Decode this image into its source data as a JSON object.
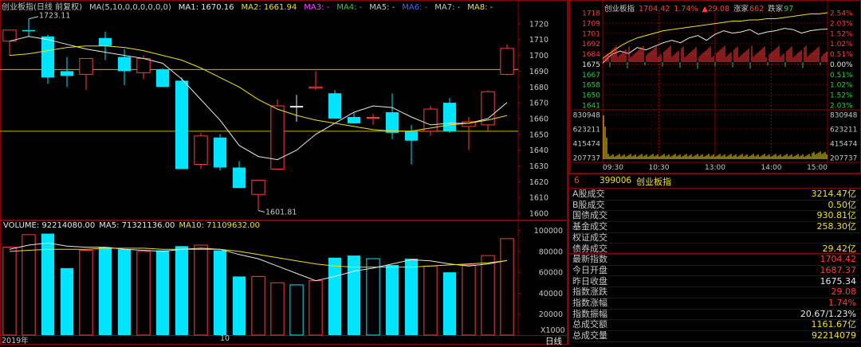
{
  "main_chart": {
    "title": "创业板指(日线 前复权)",
    "ma_legend": [
      {
        "label": "MA(5,10,0,0,0,0,0,0)",
        "color": "#c8c8c8"
      },
      {
        "label": "MA1: 1670.16",
        "color": "#e8e8e8"
      },
      {
        "label": "MA2: 1661.94",
        "color": "#f0e020"
      },
      {
        "label": "MA3: -",
        "color": "#ff40ff"
      },
      {
        "label": "MA4: -",
        "color": "#2ecc40"
      },
      {
        "label": "MA5: -",
        "color": "#c8c8c8"
      },
      {
        "label": "MA6: -",
        "color": "#3a6bff"
      },
      {
        "label": "MA7: -",
        "color": "#c8c8c8"
      },
      {
        "label": "MA8: -",
        "color": "#f0e020"
      }
    ],
    "high_annotation": "1723.11",
    "low_annotation": "1601.81",
    "y_ticks": [
      "1720",
      "1710",
      "1700",
      "1690",
      "1680",
      "1670",
      "1660",
      "1650",
      "1640",
      "1630",
      "1620",
      "1610",
      "1600"
    ]
  },
  "volume_chart": {
    "legend": [
      {
        "label": "VOLUME: 92214080.00",
        "color": "#e8e8e8"
      },
      {
        "label": "MA5: 71321136.00",
        "color": "#e8e8e8"
      },
      {
        "label": "MA10: 71109632.00",
        "color": "#f0e020"
      }
    ],
    "y_ticks": [
      "100000",
      "80000",
      "60000",
      "40000",
      "20000"
    ],
    "unit": "X1000",
    "x_labels": [
      "2019年",
      "10"
    ]
  },
  "period_label": "日线",
  "chart_data": [
    {
      "type": "candlestick",
      "title": "创业板指(日线 前复权)",
      "ylim": [
        1597,
        1728
      ],
      "candles": [
        {
          "o": 1709,
          "h": 1714,
          "l": 1700,
          "c": 1716,
          "dir": "up"
        },
        {
          "o": 1716,
          "h": 1723.11,
          "l": 1712,
          "c": 1716,
          "dir": "flat"
        },
        {
          "o": 1712,
          "h": 1713,
          "l": 1682,
          "c": 1686,
          "dir": "down"
        },
        {
          "o": 1690,
          "h": 1699,
          "l": 1680,
          "c": 1687,
          "dir": "down"
        },
        {
          "o": 1688,
          "h": 1698,
          "l": 1678,
          "c": 1698,
          "dir": "up"
        },
        {
          "o": 1711,
          "h": 1715,
          "l": 1697,
          "c": 1706,
          "dir": "down"
        },
        {
          "o": 1699,
          "h": 1704,
          "l": 1681,
          "c": 1690,
          "dir": "down"
        },
        {
          "o": 1689,
          "h": 1700,
          "l": 1685,
          "c": 1698,
          "dir": "up"
        },
        {
          "o": 1691,
          "h": 1692,
          "l": 1681,
          "c": 1680,
          "dir": "down"
        },
        {
          "o": 1684,
          "h": 1686,
          "l": 1628,
          "c": 1628,
          "dir": "down"
        },
        {
          "o": 1631,
          "h": 1651,
          "l": 1628,
          "c": 1649,
          "dir": "up"
        },
        {
          "o": 1648,
          "h": 1650,
          "l": 1627,
          "c": 1629,
          "dir": "down"
        },
        {
          "o": 1629,
          "h": 1633,
          "l": 1616,
          "c": 1616,
          "dir": "down"
        },
        {
          "o": 1612,
          "h": 1620,
          "l": 1601.81,
          "c": 1621,
          "dir": "up"
        },
        {
          "o": 1628,
          "h": 1672,
          "l": 1628,
          "c": 1668,
          "dir": "up"
        },
        {
          "o": 1667,
          "h": 1675,
          "l": 1658,
          "c": 1668,
          "dir": "flat"
        },
        {
          "o": 1680,
          "h": 1690,
          "l": 1678,
          "c": 1680,
          "dir": "up"
        },
        {
          "o": 1676,
          "h": 1678,
          "l": 1660,
          "c": 1660,
          "dir": "down"
        },
        {
          "o": 1661,
          "h": 1664,
          "l": 1657,
          "c": 1657,
          "dir": "down"
        },
        {
          "o": 1660,
          "h": 1663,
          "l": 1656,
          "c": 1661,
          "dir": "flat"
        },
        {
          "o": 1664,
          "h": 1676,
          "l": 1647,
          "c": 1651,
          "dir": "down"
        },
        {
          "o": 1652,
          "h": 1656,
          "l": 1631,
          "c": 1646,
          "dir": "down"
        },
        {
          "o": 1652,
          "h": 1668,
          "l": 1649,
          "c": 1666,
          "dir": "up"
        },
        {
          "o": 1670,
          "h": 1673,
          "l": 1651,
          "c": 1652,
          "dir": "down"
        },
        {
          "o": 1655,
          "h": 1661,
          "l": 1640,
          "c": 1658,
          "dir": "up"
        },
        {
          "o": 1656,
          "h": 1678,
          "l": 1652,
          "c": 1677,
          "dir": "up"
        },
        {
          "o": 1688,
          "h": 1707,
          "l": 1687.37,
          "c": 1704.42,
          "dir": "up"
        }
      ],
      "ma1": [
        1709,
        1712,
        1710,
        1707,
        1704,
        1702,
        1700,
        1698,
        1695,
        1685,
        1672,
        1659,
        1643,
        1636,
        1634,
        1640,
        1650,
        1657,
        1664,
        1668,
        1667,
        1661,
        1656,
        1657,
        1657,
        1660,
        1670.16
      ],
      "ma2": [
        1700,
        1701,
        1703,
        1705,
        1706,
        1706,
        1705,
        1703,
        1700,
        1697,
        1692,
        1686,
        1680,
        1672,
        1666,
        1662,
        1659,
        1657,
        1655,
        1653,
        1652,
        1652,
        1654,
        1656,
        1657,
        1659,
        1661.94
      ],
      "hlines": [
        1691,
        1652
      ]
    },
    {
      "type": "bar",
      "title": "VOLUME",
      "ylim": [
        0,
        105000
      ],
      "values": [
        84000,
        96000,
        97000,
        64000,
        81000,
        84000,
        82000,
        80000,
        81000,
        85000,
        86000,
        81000,
        56000,
        56000,
        50000,
        48000,
        52000,
        74000,
        76000,
        73000,
        67000,
        73000,
        66000,
        60000,
        67000,
        76000,
        92214
      ],
      "dirs": [
        "up",
        "up",
        "down",
        "down",
        "up",
        "down",
        "down",
        "up",
        "down",
        "down",
        "up",
        "down",
        "down",
        "up",
        "up",
        "flat",
        "up",
        "down",
        "down",
        "flat",
        "down",
        "down",
        "up",
        "down",
        "up",
        "up",
        "up"
      ],
      "ma5": [
        82000,
        86000,
        88000,
        85000,
        84000,
        84000,
        82000,
        81000,
        80000,
        82000,
        83000,
        82000,
        77000,
        73000,
        66000,
        59000,
        52000,
        56000,
        61000,
        64000,
        68000,
        72000,
        71000,
        68000,
        66000,
        68000,
        71321
      ],
      "ma10": [
        80000,
        81000,
        82000,
        82000,
        82000,
        83000,
        83000,
        83000,
        82000,
        82000,
        82000,
        82000,
        80000,
        77000,
        74000,
        71000,
        68000,
        66000,
        65000,
        65000,
        65000,
        65000,
        66000,
        67000,
        68000,
        69000,
        71109
      ]
    },
    {
      "type": "line",
      "title": "创业板指",
      "ylim": [
        1641,
        1718
      ],
      "series": [
        {
          "name": "yellow",
          "color": "#f0e020",
          "values": [
            1680,
            1685,
            1690,
            1694,
            1697,
            1699,
            1701,
            1703,
            1704,
            1705,
            1706,
            1707,
            1708,
            1709,
            1710,
            1711,
            1711,
            1712,
            1712,
            1713,
            1713,
            1714,
            1715,
            1716,
            1717,
            1717,
            1718
          ]
        },
        {
          "name": "white",
          "color": "#e8e8e8",
          "values": [
            1676,
            1683,
            1686,
            1684,
            1689,
            1687,
            1690,
            1693,
            1695,
            1693,
            1697,
            1699,
            1695,
            1700,
            1703,
            1701,
            1702,
            1704,
            1700,
            1702,
            1703,
            1705,
            1704,
            1701,
            1703,
            1704,
            1704.42
          ]
        }
      ]
    }
  ],
  "intraday": {
    "header": {
      "name": "创业板指",
      "price": "1704.42",
      "pct": "1.74%",
      "change": "▲29.08",
      "rise_label": "涨家",
      "rise_count": "662",
      "fall_label": "跌家",
      "fall_count": "97"
    },
    "left_ticks": [
      {
        "v": "1718",
        "c": "#ff3b3b"
      },
      {
        "v": "1709",
        "c": "#ff3b3b"
      },
      {
        "v": "1701",
        "c": "#ff3b3b"
      },
      {
        "v": "1692",
        "c": "#ff3b3b"
      },
      {
        "v": "1684",
        "c": "#ff3b3b"
      },
      {
        "v": "1675",
        "c": "#e8e8e8"
      },
      {
        "v": "1667",
        "c": "#2ecc40"
      },
      {
        "v": "1658",
        "c": "#2ecc40"
      },
      {
        "v": "1650",
        "c": "#2ecc40"
      },
      {
        "v": "1641",
        "c": "#2ecc40"
      }
    ],
    "right_ticks": [
      {
        "v": "2.54%",
        "c": "#ff3b3b"
      },
      {
        "v": "2.03%",
        "c": "#ff3b3b"
      },
      {
        "v": "1.52%",
        "c": "#ff3b3b"
      },
      {
        "v": "1.02%",
        "c": "#ff3b3b"
      },
      {
        "v": "0.51%",
        "c": "#ff3b3b"
      },
      {
        "v": "0.00%",
        "c": "#e8e8e8"
      },
      {
        "v": "0.51%",
        "c": "#2ecc40"
      },
      {
        "v": "1.02%",
        "c": "#2ecc40"
      },
      {
        "v": "1.52%",
        "c": "#2ecc40"
      },
      {
        "v": "2.03%",
        "c": "#2ecc40"
      }
    ],
    "vol_ticks": [
      "830948",
      "623211",
      "415474",
      "207737"
    ],
    "time_labels": [
      "09:30",
      "10:30",
      "13:00",
      "14:00",
      "15:00"
    ]
  },
  "info_panel": {
    "index_prefix": "6",
    "code": "399006",
    "name": "创业板指",
    "rows": [
      {
        "label": "A股成交",
        "value": "3214.47亿",
        "color": "#f0e020"
      },
      {
        "label": "B股成交",
        "value": "0.50亿",
        "color": "#f0e020"
      },
      {
        "label": "国债成交",
        "value": "930.81亿",
        "color": "#f0e020"
      },
      {
        "label": "基金成交",
        "value": "258.30亿",
        "color": "#f0e020"
      },
      {
        "label": "权证成交",
        "value": "",
        "color": "#f0e020"
      },
      {
        "label": "债券成交",
        "value": "29.42亿",
        "color": "#f0e020"
      },
      {
        "label": "最新指数",
        "value": "1704.42",
        "color": "#ff3b3b"
      },
      {
        "label": "今日开盘",
        "value": "1687.37",
        "color": "#ff3b3b"
      },
      {
        "label": "昨日收盘",
        "value": "1675.34",
        "color": "#e8e8e8"
      },
      {
        "label": "指数涨跌",
        "value": "29.08",
        "color": "#ff3b3b"
      },
      {
        "label": "指数涨幅",
        "value": "1.74%",
        "color": "#ff3b3b"
      },
      {
        "label": "指数振幅",
        "value": "20.67/1.23%",
        "color": "#e8e8e8"
      },
      {
        "label": "总成交额",
        "value": "1161.67亿",
        "color": "#f0e020"
      },
      {
        "label": "总成交量",
        "value": "92214079",
        "color": "#f0e020"
      }
    ]
  }
}
